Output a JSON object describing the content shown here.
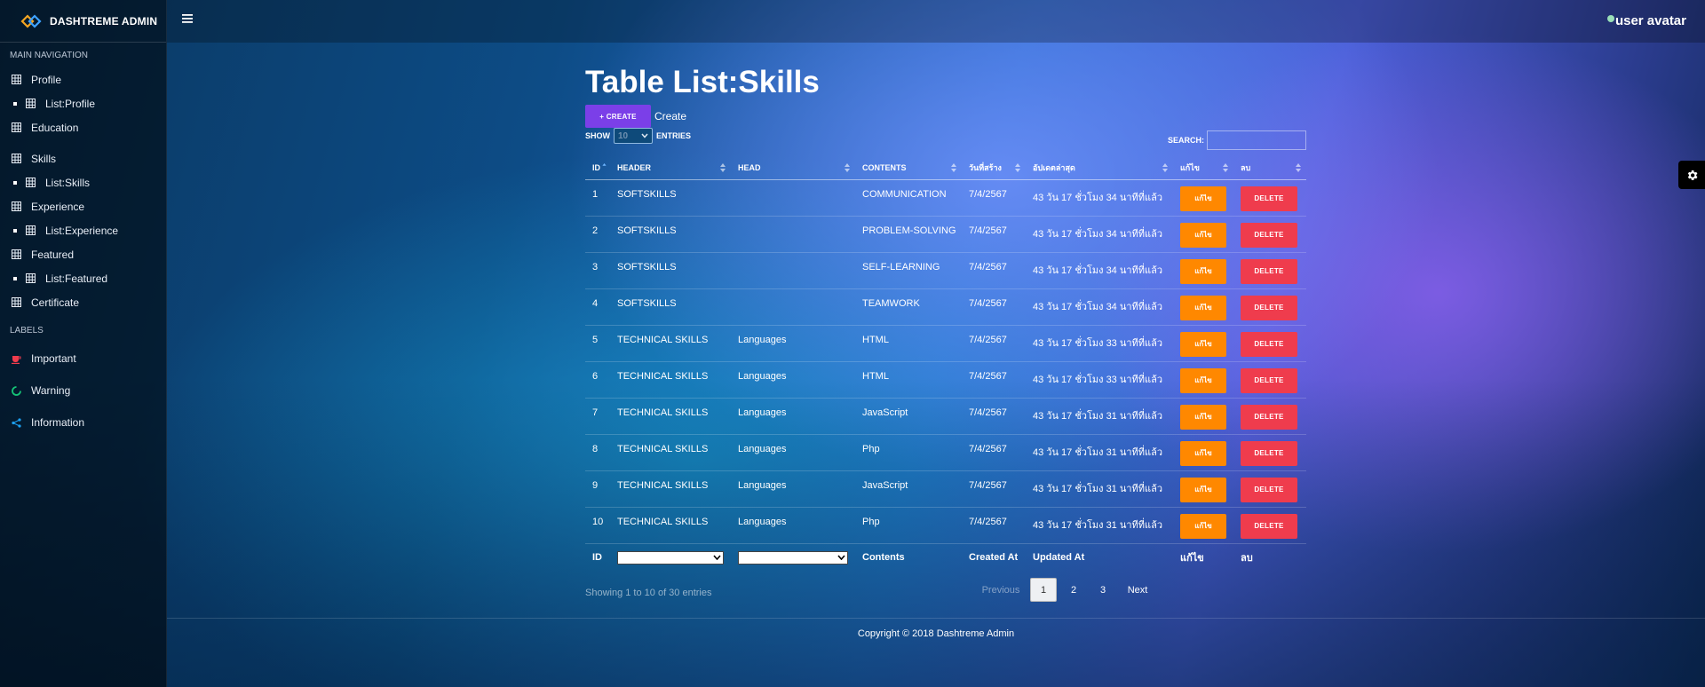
{
  "brand": {
    "title": "DASHTREME ADMIN"
  },
  "sidebar": {
    "nav_header": "MAIN NAVIGATION",
    "items": [
      {
        "label": "Profile",
        "type": "main"
      },
      {
        "label": "List:Profile",
        "type": "sub"
      },
      {
        "label": "Education",
        "type": "main"
      },
      {
        "label": "Skills",
        "type": "main"
      },
      {
        "label": "List:Skills",
        "type": "sub"
      },
      {
        "label": "Experience",
        "type": "main"
      },
      {
        "label": "List:Experience",
        "type": "sub"
      },
      {
        "label": "Featured",
        "type": "main"
      },
      {
        "label": "List:Featured",
        "type": "sub"
      },
      {
        "label": "Certificate",
        "type": "main"
      }
    ],
    "labels_header": "LABELS",
    "labels": [
      {
        "label": "Important",
        "color": "#ef3c4d",
        "icon": "coffee-icon"
      },
      {
        "label": "Warning",
        "color": "#15c377",
        "icon": "circle-notch-icon"
      },
      {
        "label": "Information",
        "color": "#1da1f2",
        "icon": "share-icon"
      }
    ]
  },
  "topbar": {
    "user_avatar_text": "user avatar"
  },
  "main": {
    "title": "Table List:Skills",
    "create_button": "+ CREATE",
    "create_link": "Create",
    "show_label": "SHOW",
    "entries_label": "ENTRIES",
    "page_length": "10",
    "search_label": "SEARCH:",
    "columns": [
      "ID",
      "HEADER",
      "HEAD",
      "CONTENTS",
      "วันที่สร้าง",
      "อัปเดตล่าสุด",
      "แก้ไข",
      "ลบ"
    ],
    "rows": [
      {
        "id": "1",
        "header": "SOFTSKILLS",
        "head": "",
        "contents": "COMMUNICATION",
        "created": "7/4/2567",
        "updated": "43 วัน 17 ชั่วโมง 34 นาทีที่แล้ว"
      },
      {
        "id": "2",
        "header": "SOFTSKILLS",
        "head": "",
        "contents": "PROBLEM-SOLVING",
        "created": "7/4/2567",
        "updated": "43 วัน 17 ชั่วโมง 34 นาทีที่แล้ว"
      },
      {
        "id": "3",
        "header": "SOFTSKILLS",
        "head": "",
        "contents": "SELF-LEARNING",
        "created": "7/4/2567",
        "updated": "43 วัน 17 ชั่วโมง 34 นาทีที่แล้ว"
      },
      {
        "id": "4",
        "header": "SOFTSKILLS",
        "head": "",
        "contents": "TEAMWORK",
        "created": "7/4/2567",
        "updated": "43 วัน 17 ชั่วโมง 34 นาทีที่แล้ว"
      },
      {
        "id": "5",
        "header": "TECHNICAL SKILLS",
        "head": "Languages",
        "contents": "HTML",
        "created": "7/4/2567",
        "updated": "43 วัน 17 ชั่วโมง 33 นาทีที่แล้ว"
      },
      {
        "id": "6",
        "header": "TECHNICAL SKILLS",
        "head": "Languages",
        "contents": "HTML",
        "created": "7/4/2567",
        "updated": "43 วัน 17 ชั่วโมง 33 นาทีที่แล้ว"
      },
      {
        "id": "7",
        "header": "TECHNICAL SKILLS",
        "head": "Languages",
        "contents": "JavaScript",
        "created": "7/4/2567",
        "updated": "43 วัน 17 ชั่วโมง 31 นาทีที่แล้ว"
      },
      {
        "id": "8",
        "header": "TECHNICAL SKILLS",
        "head": "Languages",
        "contents": "Php",
        "created": "7/4/2567",
        "updated": "43 วัน 17 ชั่วโมง 31 นาทีที่แล้ว"
      },
      {
        "id": "9",
        "header": "TECHNICAL SKILLS",
        "head": "Languages",
        "contents": "JavaScript",
        "created": "7/4/2567",
        "updated": "43 วัน 17 ชั่วโมง 31 นาทีที่แล้ว"
      },
      {
        "id": "10",
        "header": "TECHNICAL SKILLS",
        "head": "Languages",
        "contents": "Php",
        "created": "7/4/2567",
        "updated": "43 วัน 17 ชั่วโมง 31 นาทีที่แล้ว"
      }
    ],
    "edit_label": "แก้ไข",
    "delete_label": "DELETE",
    "footer_columns": {
      "id": "ID",
      "contents": "Contents",
      "created": "Created At",
      "updated": "Updated At",
      "edit": "แก้ไข",
      "delete": "ลบ"
    },
    "info": "Showing 1 to 10 of 30 entries",
    "pagination": {
      "previous": "Previous",
      "pages": [
        "1",
        "2",
        "3"
      ],
      "current": "1",
      "next": "Next"
    }
  },
  "footer": {
    "copyright": "Copyright © 2018 Dashtreme Admin"
  },
  "colors": {
    "create": "#7b3fe8",
    "edit": "#ff8800",
    "delete": "#ef3c4d"
  }
}
